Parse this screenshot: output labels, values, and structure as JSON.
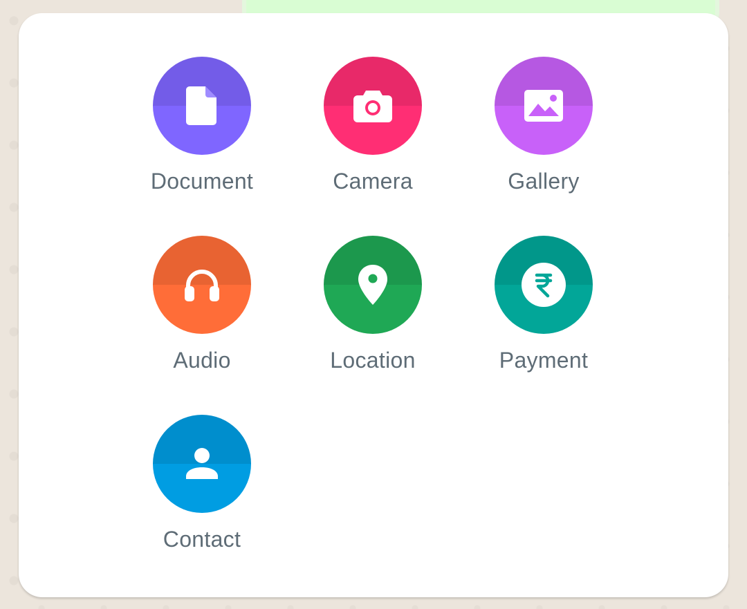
{
  "attach_menu": {
    "items": [
      {
        "label": "Document",
        "icon": "document-icon",
        "color": "#7f66ff"
      },
      {
        "label": "Camera",
        "icon": "camera-icon",
        "color": "#ff2e74"
      },
      {
        "label": "Gallery",
        "icon": "gallery-icon",
        "color": "#c861f9"
      },
      {
        "label": "Audio",
        "icon": "headphones-icon",
        "color": "#ff6d38"
      },
      {
        "label": "Location",
        "icon": "location-pin-icon",
        "color": "#1fa855"
      },
      {
        "label": "Payment",
        "icon": "rupee-icon",
        "color": "#02a698"
      },
      {
        "label": "Contact",
        "icon": "contact-person-icon",
        "color": "#009de2"
      }
    ]
  }
}
